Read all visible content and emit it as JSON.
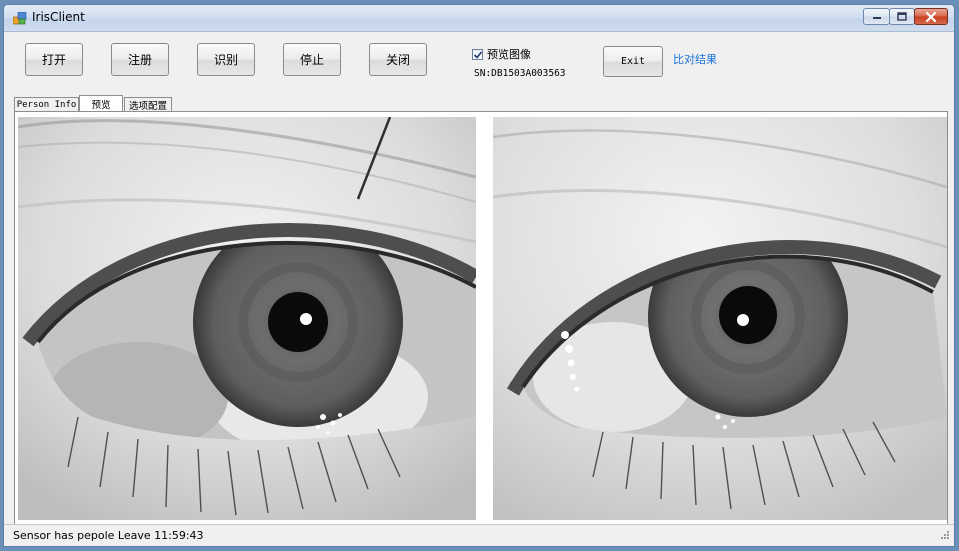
{
  "window": {
    "title": "IrisClient",
    "icon": "app-icon",
    "controls": [
      "minimize-icon",
      "maximize-icon",
      "close-icon"
    ]
  },
  "toolbar": {
    "open_label": "打开",
    "register_label": "注册",
    "identify_label": "识别",
    "stop_label": "停止",
    "close_label": "关闭",
    "exit_label": "Exit"
  },
  "preview": {
    "checkbox_label": "预览图像",
    "checked": true,
    "sn": "SN:DB1503A003563"
  },
  "compare_link": "比对结果",
  "tabs": [
    {
      "label": "Person Info"
    },
    {
      "label": "预览"
    },
    {
      "label": "选项配置"
    }
  ],
  "active_tab": "预览",
  "status": {
    "text": "Sensor has pepole Leave 11:59:43"
  },
  "colors": {
    "link": "#1a72d9",
    "close_button": "#c83f1f"
  }
}
